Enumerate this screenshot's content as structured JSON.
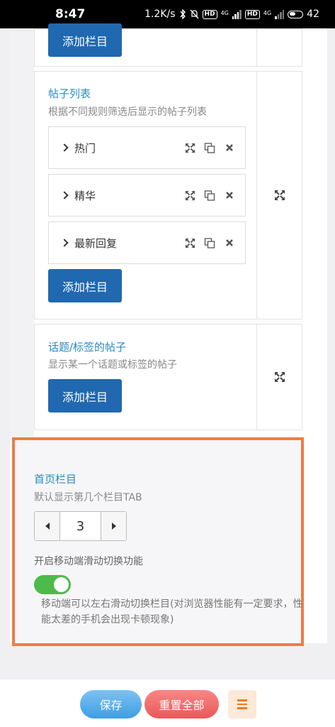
{
  "status": {
    "time": "8:47",
    "net_speed": "1.2K/s",
    "hd": "HD",
    "lte": "4G",
    "battery": "42"
  },
  "cards": [
    {
      "add_label": "添加栏目"
    },
    {
      "title": "帖子列表",
      "desc": "根据不同规则筛选后显示的帖子列表",
      "items": [
        {
          "label": "热门"
        },
        {
          "label": "精华"
        },
        {
          "label": "最新回复"
        }
      ],
      "add_label": "添加栏目"
    },
    {
      "title": "话题/标签的帖子",
      "desc": "显示某一个话题或标签的帖子",
      "add_label": "添加栏目"
    }
  ],
  "home_tab": {
    "title": "首页栏目",
    "desc": "默认显示第几个栏目TAB",
    "value": "3",
    "swipe_label": "开启移动端滑动切换功能",
    "swipe_enabled": true,
    "swipe_help": "移动端可以左右滑动切换栏目(对浏览器性能有一定要求，性能太差的手机会出现卡顿现象)"
  },
  "bottom": {
    "save_label": "保存",
    "reset_label": "重置全部"
  },
  "colors": {
    "accent": "#2068b0",
    "title": "#2a8ac4",
    "highlight": "#f07b45",
    "toggle": "#4cbb4a"
  },
  "icons": [
    "expand-icon",
    "copy-icon",
    "close-icon",
    "chevron-right-icon",
    "menu-icon"
  ]
}
